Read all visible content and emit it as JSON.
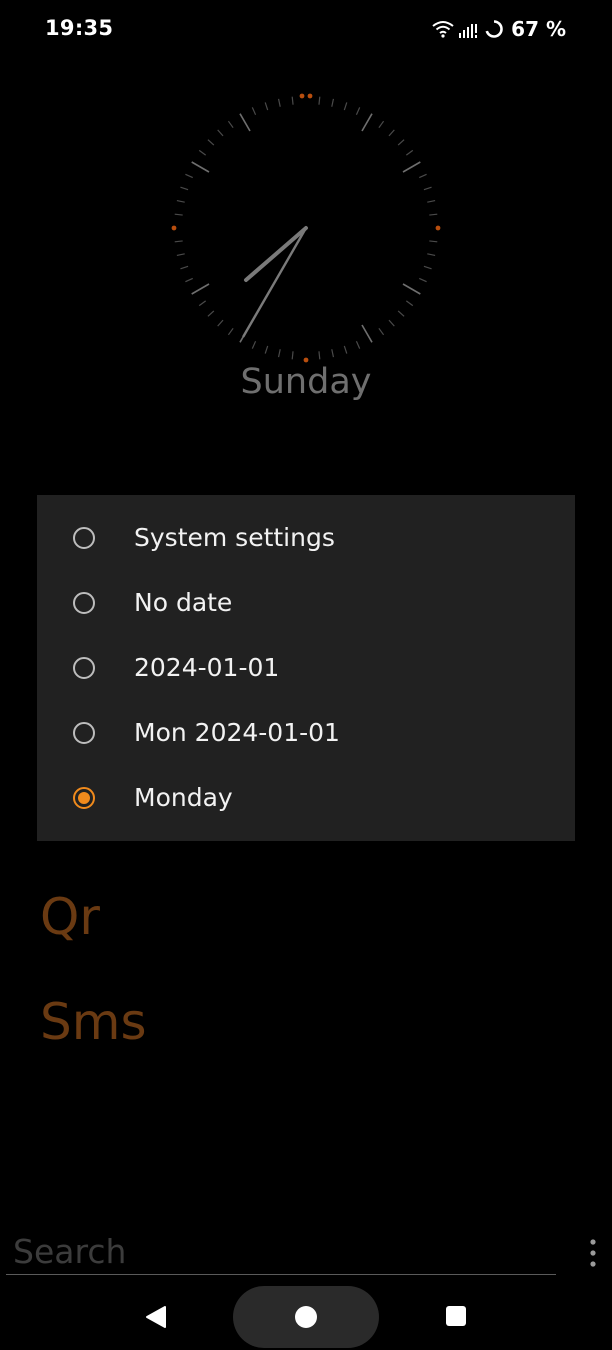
{
  "status_bar": {
    "time": "19:35",
    "battery": "67 %",
    "icons": [
      "wifi-icon",
      "signal-icon",
      "battery-ring-icon"
    ]
  },
  "clock": {
    "hour_hand_angle": 40,
    "minute_hand_angle": 210,
    "day": "Sunday",
    "accent_color": "#b84e0e",
    "hand_color": "#7a7a7a"
  },
  "date_format_dialog": {
    "options": [
      {
        "label": "System settings",
        "selected": false
      },
      {
        "label": "No date",
        "selected": false
      },
      {
        "label": "2024-01-01",
        "selected": false
      },
      {
        "label": "Mon 2024-01-01",
        "selected": false
      },
      {
        "label": "Monday",
        "selected": true
      }
    ],
    "accent_color": "#f08a1c"
  },
  "apps": [
    {
      "label": "Qr"
    },
    {
      "label": "Sms"
    }
  ],
  "search": {
    "placeholder": "Search",
    "value": ""
  },
  "navigation": {
    "icons": [
      "back-icon",
      "home-icon",
      "recents-icon"
    ]
  }
}
